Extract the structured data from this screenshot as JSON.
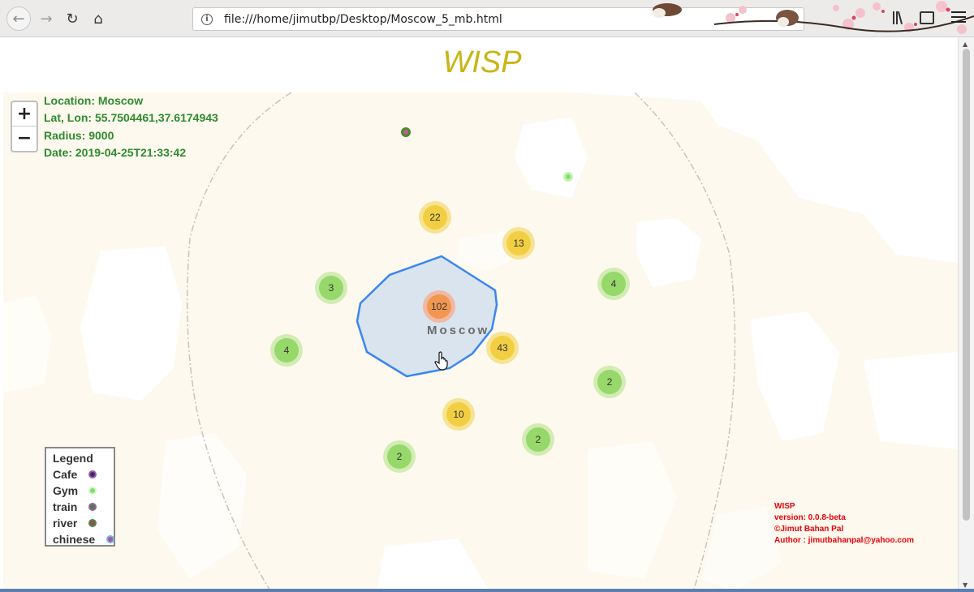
{
  "browser": {
    "url": "file:///home/jimutbp/Desktop/Moscow_5_mb.html",
    "icons": [
      "back-arrow-icon",
      "forward-arrow-icon",
      "reload-icon",
      "home-icon",
      "info-icon",
      "pocket-icon",
      "library-icon",
      "sidebar-icon",
      "menu-icon"
    ]
  },
  "page": {
    "title": "WISP"
  },
  "zoom": {
    "in_label": "+",
    "out_label": "−"
  },
  "info": {
    "location": "Location: Moscow",
    "latlon": "Lat, Lon: 55.7504461,37.6174943",
    "radius": "Radius: 9000",
    "date": "Date: 2019-04-25T21:33:42"
  },
  "map": {
    "city_label": "Moscow",
    "polygon_color": "#3a86f0",
    "clusters": [
      {
        "count": "22",
        "level": "medium"
      },
      {
        "count": "13",
        "level": "medium"
      },
      {
        "count": "3",
        "level": "small"
      },
      {
        "count": "4",
        "level": "small"
      },
      {
        "count": "102",
        "level": "large"
      },
      {
        "count": "43",
        "level": "medium"
      },
      {
        "count": "4",
        "level": "small"
      },
      {
        "count": "2",
        "level": "small"
      },
      {
        "count": "10",
        "level": "medium"
      },
      {
        "count": "2",
        "level": "small"
      },
      {
        "count": "2",
        "level": "small"
      }
    ],
    "markers": [
      {
        "type": "train",
        "color": "#c05a9e",
        "border": "#4a8a2a"
      },
      {
        "type": "Gym",
        "color": "#7de06a",
        "border": "#c9f0b0"
      }
    ]
  },
  "legend": {
    "title": "Legend",
    "items": [
      {
        "label": "Cafe",
        "color": "#3a2d6b"
      },
      {
        "label": "Gym",
        "color": "#7de06a"
      },
      {
        "label": "train",
        "color": "#3a8a3a"
      },
      {
        "label": "river",
        "color": "#a04a4a"
      },
      {
        "label": "chinese",
        "color": "#a05aa0"
      }
    ]
  },
  "credits": {
    "line1": "WISP",
    "line2": "version: 0.0.8-beta",
    "line3": "©Jimut Bahan Pal",
    "line4": "Author : jimutbahanpal@yahoo.com"
  }
}
